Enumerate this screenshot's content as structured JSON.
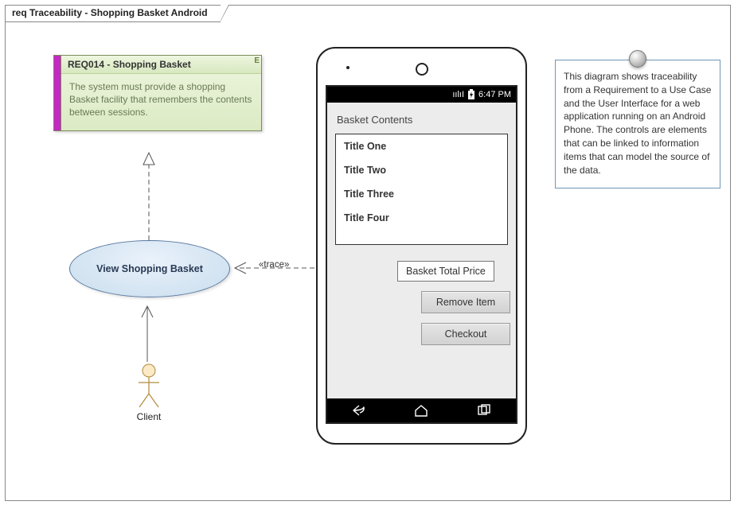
{
  "frame": {
    "title": "req Traceability - Shopping Basket Android"
  },
  "requirement": {
    "title": "REQ014 - Shopping Basket",
    "body": "The system must provide a shopping Basket facility that remembers the contents between sessions."
  },
  "usecase": {
    "name": "View Shopping Basket"
  },
  "actor": {
    "name": "Client"
  },
  "trace_stereotype": "«trace»",
  "phone": {
    "status_time": "6:47 PM",
    "screen_label": "Basket Contents",
    "list_items": [
      "Title One",
      "Title Two",
      "Title Three",
      "Title Four"
    ],
    "total_label": "Basket Total Price",
    "remove_label": "Remove Item",
    "checkout_label": "Checkout"
  },
  "note": {
    "text": "This diagram shows traceability from a Requirement to a Use Case and the User Interface for a web application running on an Android Phone. The controls are elements that can be linked to information items that can model the source of the data."
  }
}
